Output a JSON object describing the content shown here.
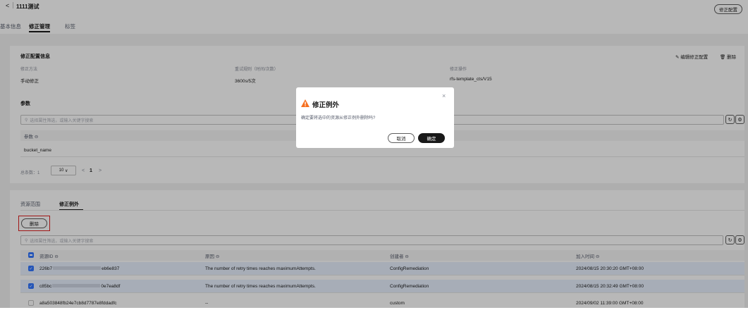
{
  "header": {
    "back_icon": "chevron-left-icon",
    "title": "1111测试",
    "right_button": "修正配置",
    "tabs": [
      {
        "label": "基本信息"
      },
      {
        "label": "修正管理"
      },
      {
        "label": "标签"
      }
    ]
  },
  "config": {
    "title": "修正配置信息",
    "edit_label": "编辑修正配置",
    "delete_label": "删除",
    "fields": [
      {
        "label": "修正方法",
        "value": "手动修正"
      },
      {
        "label": "重试规则（时间/次数）",
        "value": "3600s/5次"
      },
      {
        "label": "修正操作",
        "value": "rfs-template_cts/V15"
      }
    ]
  },
  "params": {
    "title": "参数",
    "search_placeholder": "选择属性筛选，或输入关键字搜索",
    "column": "参数",
    "rows": [
      "bucket_name"
    ],
    "total_label": "总条数：1",
    "page_size": "10",
    "current_page": "1"
  },
  "exceptions": {
    "tabs": [
      {
        "label": "资源范围"
      },
      {
        "label": "修正例外"
      }
    ],
    "delete_button": "删除",
    "search_placeholder": "选择属性筛选，或输入关键字搜索",
    "columns": [
      "资源ID",
      "原因",
      "创建者",
      "加入时间"
    ],
    "rows": [
      {
        "id": "226b7",
        "id_tail": "eb6e837",
        "reason": "The number of retry times reaches maximumAttempts.",
        "creator": "ConfigRemediation",
        "time": "2024/08/15 20:30:20 GMT+08:00",
        "checked": true
      },
      {
        "id": "c85bc",
        "id_tail": "0e7ea8df",
        "reason": "The number of retry times reaches maximumAttempts.",
        "creator": "ConfigRemediation",
        "time": "2024/08/15 20:32:49 GMT+08:00",
        "checked": true
      },
      {
        "id": "a8a503848fb24e7cb8d7787e8fddadfc",
        "id_tail": "",
        "reason": "--",
        "creator": "custom",
        "time": "2024/09/02 11:39:00 GMT+08:00",
        "checked": false
      }
    ]
  },
  "dialog": {
    "title": "修正例外",
    "message": "确定要将选中的资源从修正例外删除吗?",
    "cancel": "取消",
    "confirm": "确定",
    "warning_color": "#f66f1f"
  }
}
